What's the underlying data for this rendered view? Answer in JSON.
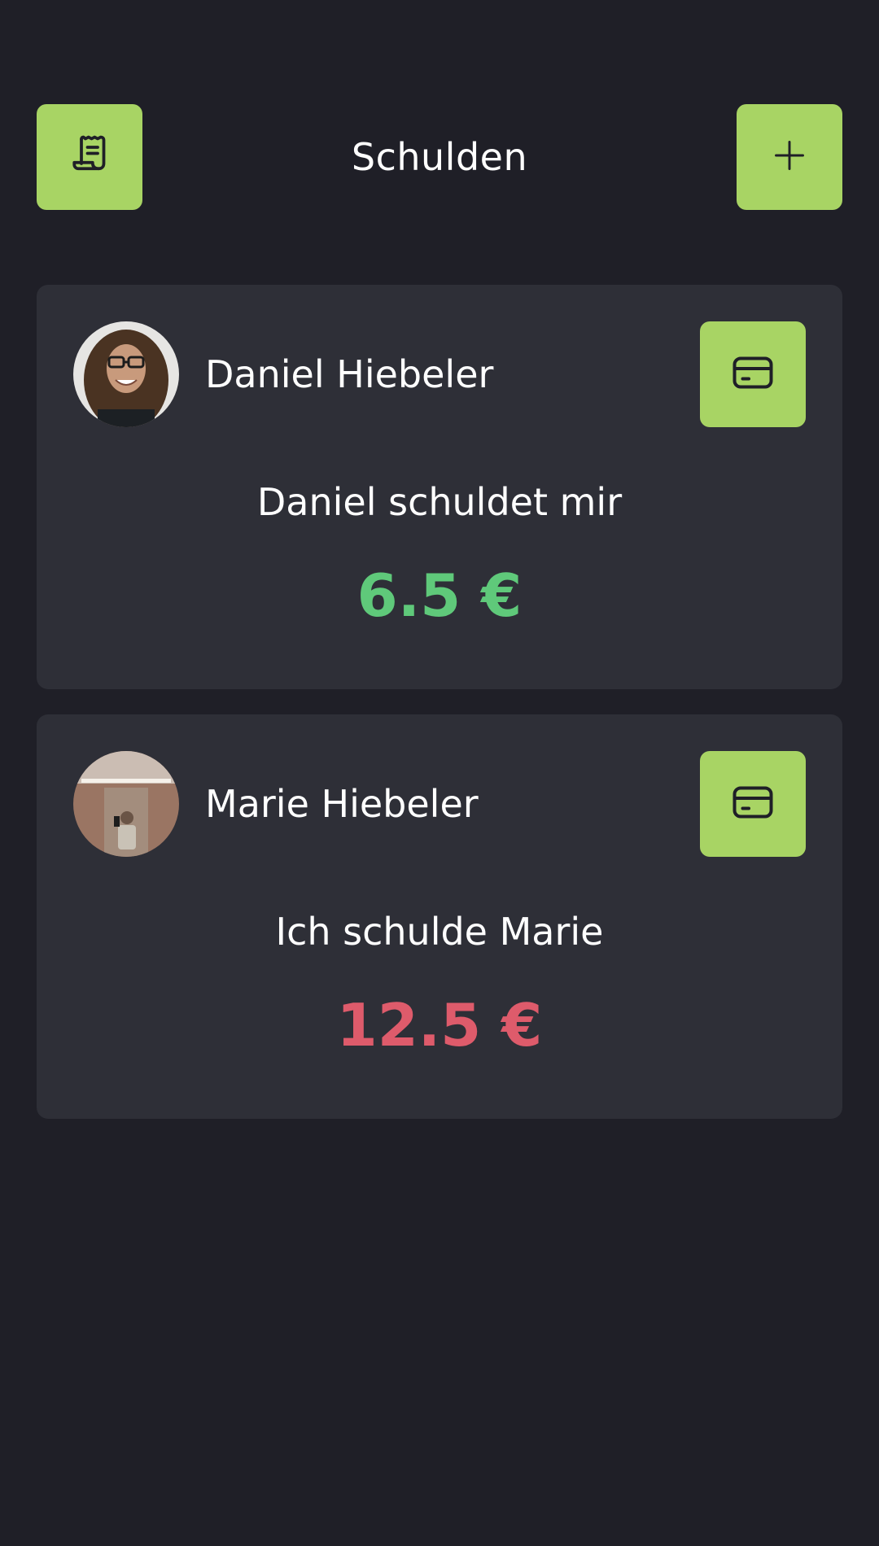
{
  "header": {
    "title": "Schulden",
    "left_icon": "receipt-icon",
    "right_icon": "plus-icon"
  },
  "colors": {
    "background": "#1f1f27",
    "card": "#2e2f37",
    "accent": "#a8d464",
    "positive": "#5fc97a",
    "negative": "#de5b6b"
  },
  "debts": [
    {
      "name": "Daniel Hiebeler",
      "text": "Daniel schuldet mir",
      "amount": "6.5 €",
      "direction": "owed-to-me",
      "action_icon": "credit-card-icon"
    },
    {
      "name": "Marie Hiebeler",
      "text": "Ich schulde Marie",
      "amount": "12.5 €",
      "direction": "i-owe",
      "action_icon": "credit-card-icon"
    }
  ]
}
